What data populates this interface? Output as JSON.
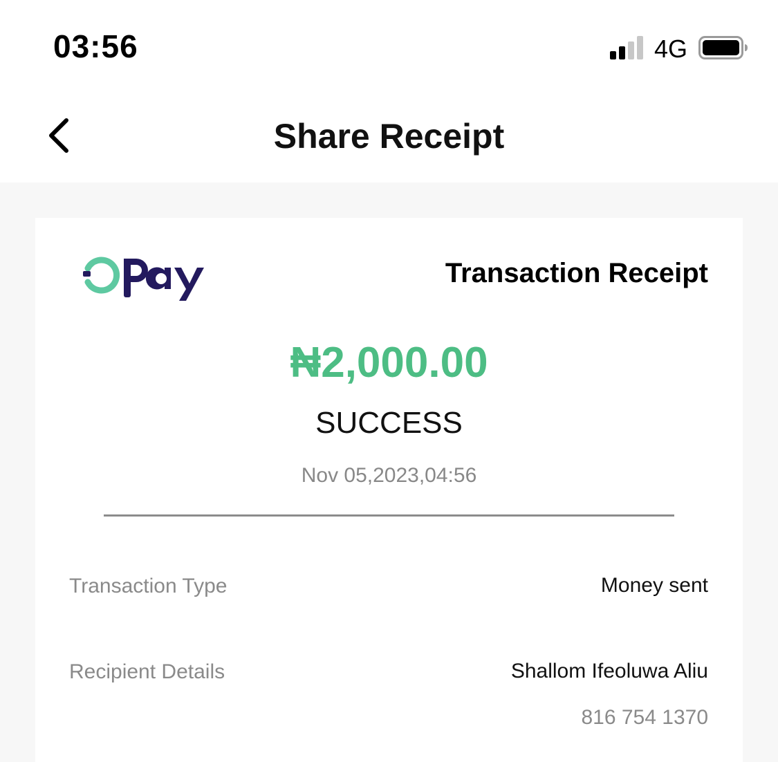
{
  "status_bar": {
    "time": "03:56",
    "network": "4G",
    "signal_bars_filled": 2,
    "signal_bars_total": 4,
    "battery_level": "high"
  },
  "nav": {
    "title": "Share Receipt",
    "back_icon": "chevron-left-icon"
  },
  "receipt": {
    "brand": "OPay",
    "heading": "Transaction Receipt",
    "amount": "₦2,000.00",
    "status": "SUCCESS",
    "datetime": "Nov 05,2023,04:56",
    "rows": [
      {
        "label": "Transaction Type",
        "value": "Money sent"
      },
      {
        "label": "Recipient Details",
        "value": "Shallom Ifeoluwa Aliu",
        "sub": "816 754 1370"
      }
    ]
  },
  "colors": {
    "accent": "#4dbd84",
    "brand_navy": "#231a5e",
    "brand_green": "#5ec9a1",
    "content_bg": "#f7f7f7"
  }
}
